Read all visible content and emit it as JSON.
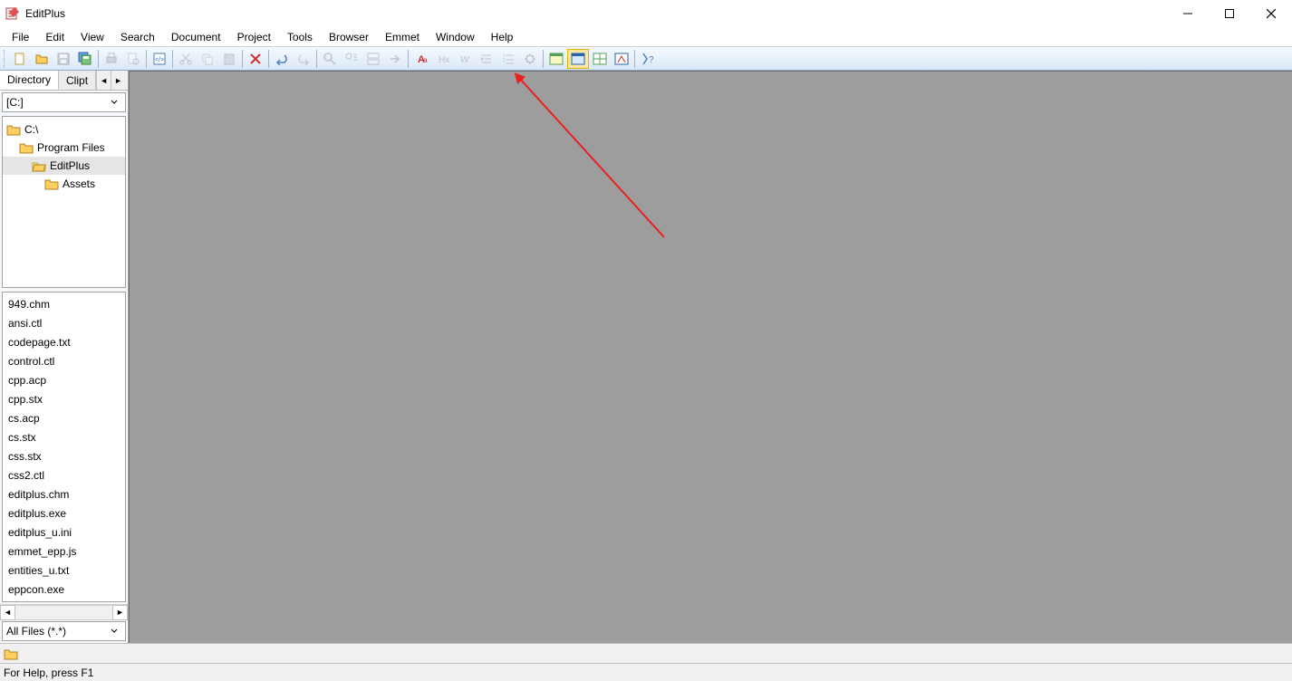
{
  "title": "EditPlus",
  "menu": [
    "File",
    "Edit",
    "View",
    "Search",
    "Document",
    "Project",
    "Tools",
    "Browser",
    "Emmet",
    "Window",
    "Help"
  ],
  "sidebar": {
    "tabs": {
      "dir": "Directory",
      "clip": "Clipt"
    },
    "drive": "[C:]",
    "tree": [
      {
        "label": "C:\\",
        "depth": 0,
        "sel": false
      },
      {
        "label": "Program Files",
        "depth": 1,
        "sel": false
      },
      {
        "label": "EditPlus",
        "depth": 2,
        "sel": true
      },
      {
        "label": "Assets",
        "depth": 3,
        "sel": false
      }
    ],
    "files": [
      "949.chm",
      "ansi.ctl",
      "codepage.txt",
      "control.ctl",
      "cpp.acp",
      "cpp.stx",
      "cs.acp",
      "cs.stx",
      "css.stx",
      "css2.ctl",
      "editplus.chm",
      "editplus.exe",
      "editplus_u.ini",
      "emmet_epp.js",
      "entities_u.txt",
      "eppcon.exe"
    ],
    "filter": "All Files (*.*)"
  },
  "status": "For Help, press F1",
  "toolbar_icons": [
    "new-file-icon",
    "open-icon",
    "save-icon",
    "save-all-icon",
    "sep",
    "print-icon",
    "print-preview-icon",
    "sep",
    "hex-icon",
    "sep",
    "cut-icon",
    "copy-icon",
    "paste-icon",
    "sep",
    "delete-icon",
    "sep",
    "undo-icon",
    "redo-icon",
    "sep",
    "find-icon",
    "find-next-icon",
    "replace-icon",
    "goto-icon",
    "sep",
    "font-icon",
    "heading-icon",
    "word-wrap-icon",
    "indent-icon",
    "line-numbers-icon",
    "settings-icon",
    "sep",
    "browser-icon",
    "browser-active-icon",
    "browser2-icon",
    "browser3-icon",
    "sep",
    "help-icon"
  ]
}
